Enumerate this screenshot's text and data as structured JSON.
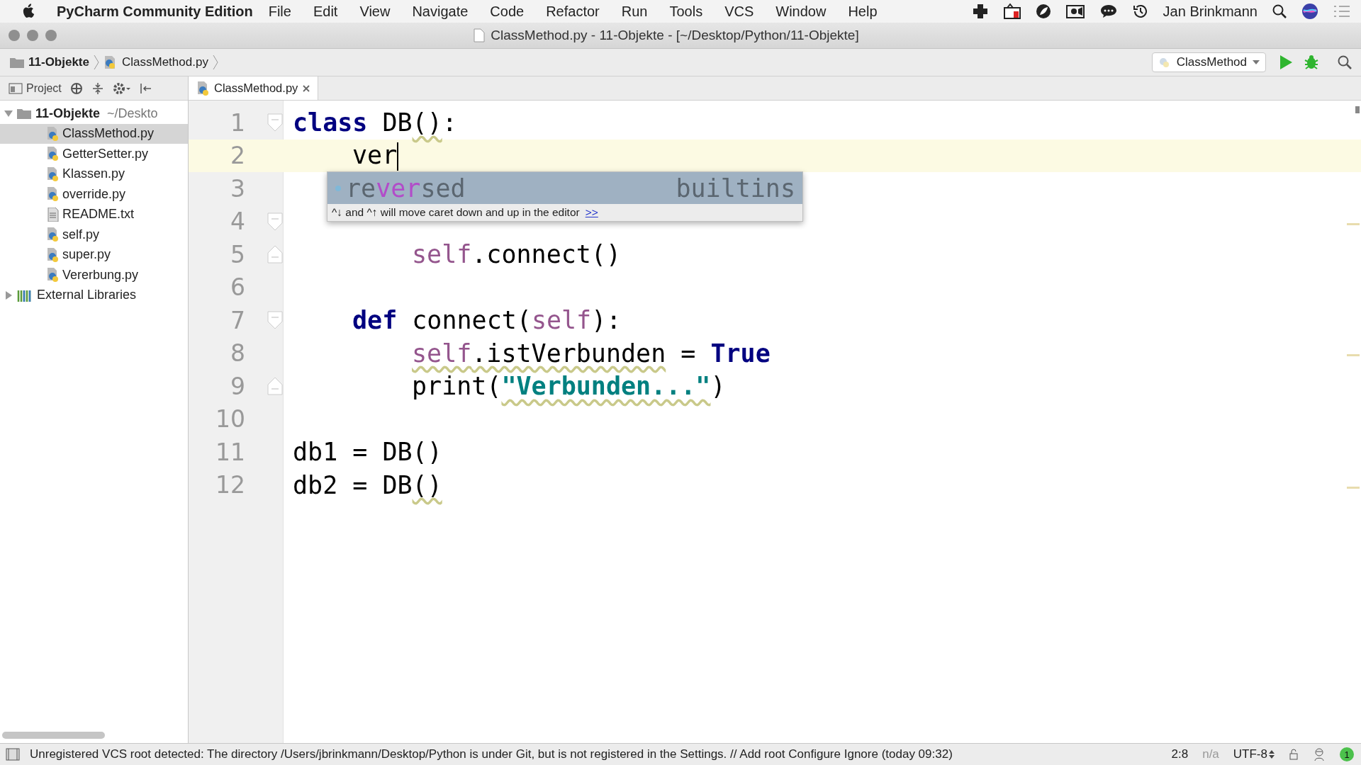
{
  "menu_bar": {
    "app_name": "PyCharm Community Edition",
    "items": [
      "File",
      "Edit",
      "View",
      "Navigate",
      "Code",
      "Refactor",
      "Run",
      "Tools",
      "VCS",
      "Window",
      "Help"
    ],
    "user": "Jan Brinkmann"
  },
  "window": {
    "title": "ClassMethod.py - 11-Objekte - [~/Desktop/Python/11-Objekte]"
  },
  "breadcrumb": [
    "11-Objekte",
    "ClassMethod.py"
  ],
  "run_config": "ClassMethod",
  "project_panel": {
    "label": "Project",
    "root": {
      "name": "11-Objekte",
      "path": "~/Deskto",
      "expanded": true,
      "children": [
        {
          "name": "ClassMethod.py",
          "kind": "py",
          "selected": true
        },
        {
          "name": "GetterSetter.py",
          "kind": "py",
          "selected": false
        },
        {
          "name": "Klassen.py",
          "kind": "py",
          "selected": false
        },
        {
          "name": "override.py",
          "kind": "py",
          "selected": false
        },
        {
          "name": "README.txt",
          "kind": "txt",
          "selected": false
        },
        {
          "name": "self.py",
          "kind": "py",
          "selected": false
        },
        {
          "name": "super.py",
          "kind": "py",
          "selected": false
        },
        {
          "name": "Vererbung.py",
          "kind": "py",
          "selected": false
        }
      ]
    },
    "libraries": {
      "name": "External Libraries",
      "expanded": false
    }
  },
  "tabs": [
    {
      "label": "ClassMethod.py",
      "selected": true
    }
  ],
  "editor": {
    "lines": [
      {
        "number": "1",
        "current": false,
        "fold_start": true,
        "tokens": [
          {
            "text": "class",
            "kind": "kw"
          },
          {
            "text": " DB",
            "kind": "plain"
          },
          {
            "text": "()",
            "kind": "plain",
            "warn": true
          },
          {
            "text": ":",
            "kind": "plain"
          }
        ]
      },
      {
        "number": "2",
        "current": true,
        "caret": true,
        "tokens": [
          {
            "text": "    ver",
            "kind": "plain"
          }
        ]
      },
      {
        "number": "3",
        "current": false
      },
      {
        "number": "4",
        "current": false,
        "fold_start": true
      },
      {
        "number": "5",
        "current": false,
        "fold_end": true,
        "tokens": [
          {
            "text": "        self",
            "kind": "self"
          },
          {
            "text": ".connect()",
            "kind": "plain"
          }
        ]
      },
      {
        "number": "6",
        "current": false
      },
      {
        "number": "7",
        "current": false,
        "fold_start": true,
        "tokens": [
          {
            "text": "    def",
            "kind": "kw"
          },
          {
            "text": " connect(",
            "kind": "plain"
          },
          {
            "text": "self",
            "kind": "self"
          },
          {
            "text": "):",
            "kind": "plain"
          }
        ]
      },
      {
        "number": "8",
        "current": false,
        "tokens": [
          {
            "text": "        self",
            "kind": "self",
            "warn": true
          },
          {
            "text": ".istVerbunden",
            "kind": "plain",
            "warn": true
          },
          {
            "text": " = ",
            "kind": "plain"
          },
          {
            "text": "True",
            "kind": "kw"
          }
        ]
      },
      {
        "number": "9",
        "current": false,
        "fold_end": true,
        "tokens": [
          {
            "text": "        print(",
            "kind": "plain"
          },
          {
            "text": "\"Verbunden...\"",
            "kind": "str",
            "warn": true
          },
          {
            "text": ")",
            "kind": "plain"
          }
        ]
      },
      {
        "number": "10",
        "current": false
      },
      {
        "number": "11",
        "current": false,
        "tokens": [
          {
            "text": "db1 = DB()",
            "kind": "plain"
          }
        ]
      },
      {
        "number": "12",
        "current": false,
        "tokens": [
          {
            "text": "db2 = DB",
            "kind": "plain"
          },
          {
            "text": "()",
            "kind": "plain",
            "warn": true
          }
        ]
      }
    ]
  },
  "completion": {
    "before": "re",
    "match": "ver",
    "after": "sed",
    "source": "builtins",
    "hint": "^↓ and ^↑ will move caret down and up in the editor",
    "link": ">>"
  },
  "status_bar": {
    "message": "Unregistered VCS root detected: The directory /Users/jbrinkmann/Desktop/Python is under Git, but is not registered in the Settings. // Add root  Configure  Ignore (today 09:32)",
    "position": "2:8",
    "na": "n/a",
    "encoding": "UTF-8",
    "notifications": "1"
  }
}
